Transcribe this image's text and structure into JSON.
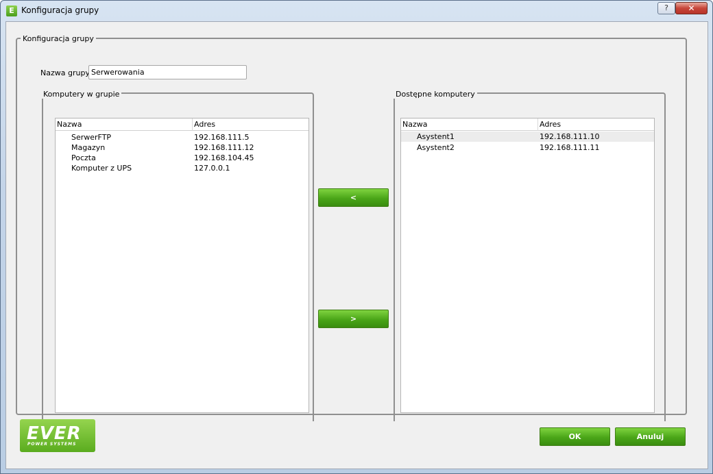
{
  "window": {
    "title": "Konfiguracja grupy",
    "icon_letter": "E",
    "help_label": "?",
    "close_label": "✕"
  },
  "main_group": {
    "title": "Konfiguracja grupy",
    "name_label": "Nazwa grupy",
    "name_value": "Serwerowania"
  },
  "left_panel": {
    "title": "Komputery w grupie",
    "columns": [
      "Nazwa",
      "Adres"
    ],
    "rows": [
      {
        "name": "SerwerFTP",
        "address": "192.168.111.5"
      },
      {
        "name": "Magazyn",
        "address": "192.168.111.12"
      },
      {
        "name": "Poczta",
        "address": "192.168.104.45"
      },
      {
        "name": "Komputer z UPS",
        "address": "127.0.0.1"
      }
    ]
  },
  "right_panel": {
    "title": "Dostępne komputery",
    "columns": [
      "Nazwa",
      "Adres"
    ],
    "rows": [
      {
        "name": "Asystent1",
        "address": "192.168.111.10"
      },
      {
        "name": "Asystent2",
        "address": "192.168.111.11"
      }
    ]
  },
  "transfer": {
    "add_label": "<",
    "remove_label": ">"
  },
  "footer": {
    "ok_label": "OK",
    "cancel_label": "Anuluj",
    "logo_text": "EVER",
    "logo_subtext": "POWER SYSTEMS"
  },
  "colors": {
    "accent_green": "#4aa518",
    "logo_green": "#7cc23a"
  }
}
